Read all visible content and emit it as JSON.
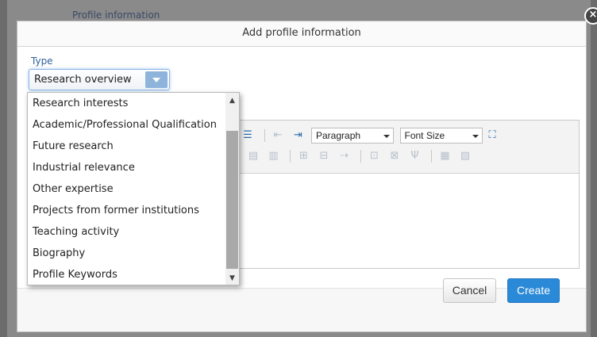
{
  "background": {
    "page_title": "Profile information"
  },
  "dialog": {
    "title": "Add profile information",
    "close_glyph": "×",
    "type_label": "Type",
    "type_selected": "Research overview",
    "dropdown_options": [
      "Research interests",
      "Academic/Professional Qualification",
      "Future research",
      "Industrial relevance",
      "Other expertise",
      "Projects from former institutions",
      "Teaching activity",
      "Biography",
      "Profile Keywords"
    ],
    "toolbar": {
      "format_select": "Paragraph",
      "size_select": "Font Size"
    },
    "buttons": {
      "cancel": "Cancel",
      "create": "Create"
    }
  },
  "colors": {
    "accent": "#2b8ad8",
    "select_border": "#8cb4e3"
  },
  "icons": {
    "toolbar_row1": [
      "list-icon",
      "outdent-icon",
      "indent-icon"
    ],
    "toolbar_row2": [
      "image-icon",
      "table-icon",
      "table-row-icon",
      "table-col-icon",
      "table-merge-icon",
      "cell-icon",
      "cell-props-icon",
      "split-icon",
      "grid-icon",
      "grid2-icon"
    ]
  }
}
